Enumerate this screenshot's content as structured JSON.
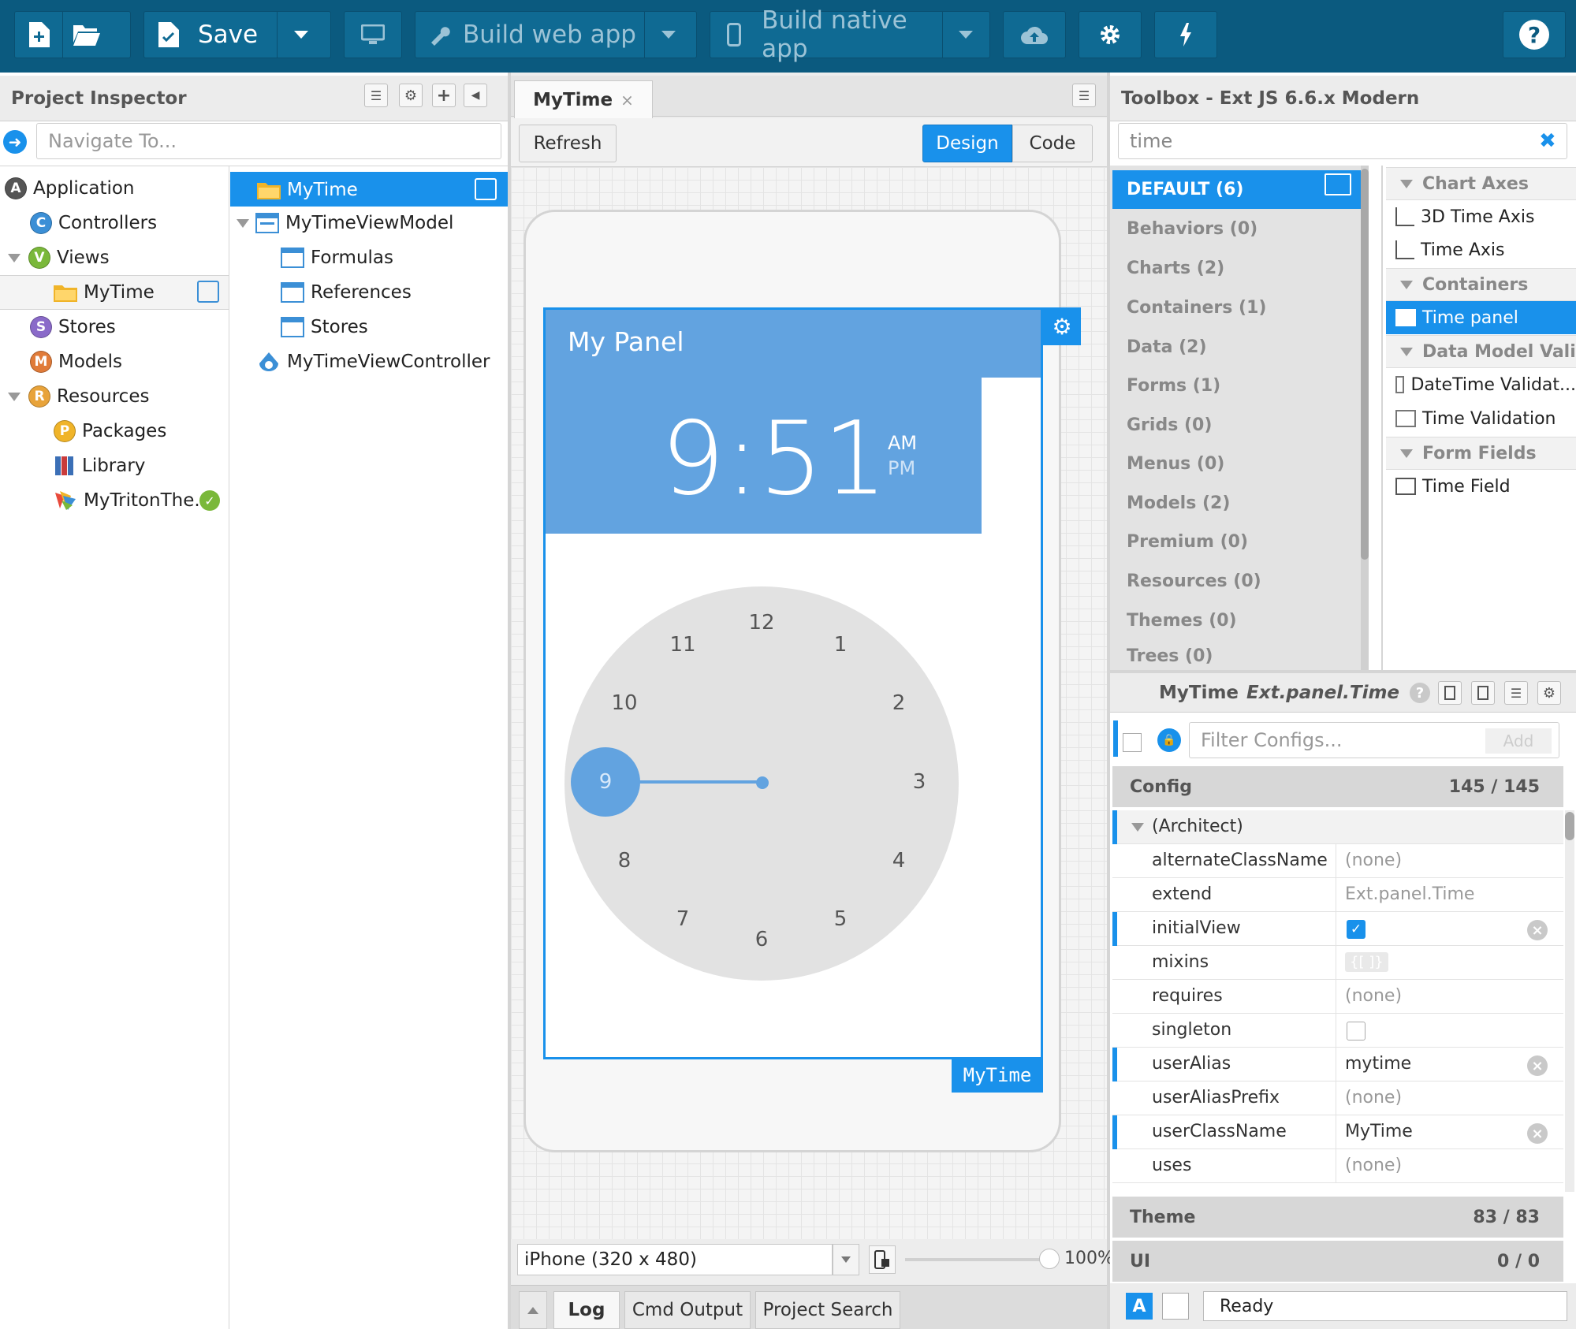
{
  "toolbar": {
    "save_label": "Save",
    "build_web_label": "Build web app",
    "build_native_label": "Build native app",
    "help_label": "?"
  },
  "project_inspector": {
    "title": "Project Inspector",
    "search_placeholder": "Navigate To...",
    "tree": [
      {
        "label": "Application",
        "icon": "A",
        "color": "#555555"
      },
      {
        "label": "Controllers",
        "icon": "C",
        "color": "#3b8fd6"
      },
      {
        "label": "Views",
        "icon": "V",
        "color": "#7ab83a"
      },
      {
        "label": "MyTime"
      },
      {
        "label": "Stores",
        "icon": "S",
        "color": "#8a6ac9"
      },
      {
        "label": "Models",
        "icon": "M",
        "color": "#e07b39"
      },
      {
        "label": "Resources",
        "icon": "R",
        "color": "#e8a33a"
      },
      {
        "label": "Packages",
        "icon": "P",
        "color": "#f0b429"
      },
      {
        "label": "Library"
      },
      {
        "label": "MyTritonThe.."
      }
    ],
    "detail_tree": [
      {
        "label": "MyTime"
      },
      {
        "label": "MyTimeViewModel"
      },
      {
        "label": "Formulas"
      },
      {
        "label": "References"
      },
      {
        "label": "Stores"
      },
      {
        "label": "MyTimeViewController"
      }
    ]
  },
  "canvas": {
    "tab_label": "MyTime",
    "tab_close": "×",
    "refresh_label": "Refresh",
    "design_label": "Design",
    "code_label": "Code",
    "panel_title": "My Panel",
    "time_text": "9:51",
    "am_label": "AM",
    "pm_label": "PM",
    "selected_hour": "9",
    "clock_numbers": [
      "12",
      "1",
      "2",
      "3",
      "4",
      "5",
      "6",
      "7",
      "8",
      "10",
      "11"
    ],
    "component_tag": "MyTime",
    "device_select": "iPhone (320 x 480)",
    "zoom_label": "100%",
    "accent_color": "#62a3e0"
  },
  "bottom_tabs": [
    "Log",
    "Cmd Output",
    "Project Search"
  ],
  "toolbox": {
    "title": "Toolbox - Ext JS 6.6.x Modern",
    "search_value": "time",
    "categories": [
      {
        "label": "DEFAULT (6)"
      },
      {
        "label": "Behaviors (0)"
      },
      {
        "label": "Charts (2)"
      },
      {
        "label": "Containers (1)"
      },
      {
        "label": "Data (2)"
      },
      {
        "label": "Forms (1)"
      },
      {
        "label": "Grids (0)"
      },
      {
        "label": "Menus (0)"
      },
      {
        "label": "Models (2)"
      },
      {
        "label": "Premium (0)"
      },
      {
        "label": "Resources (0)"
      },
      {
        "label": "Themes (0)"
      },
      {
        "label": "Trees (0)"
      }
    ],
    "section_chart_axes": "Chart Axes",
    "item_3d_time_axis": "3D Time Axis",
    "item_time_axis": "Time Axis",
    "section_containers": "Containers",
    "item_time_panel": "Time panel",
    "section_data_model": "Data Model Vali...",
    "item_datetime_validation": "DateTime Validat...",
    "item_time_validation": "Time Validation",
    "section_form_fields": "Form Fields",
    "item_time_field": "Time Field"
  },
  "config_panel": {
    "component_name": "MyTime",
    "component_class": "Ext.panel.Time",
    "filter_placeholder": "Filter Configs...",
    "add_label": "Add",
    "config_header": "Config",
    "config_count": "145 / 145",
    "architect_group": "(Architect)",
    "rows": [
      {
        "key": "alternateClassName",
        "value": "(none)"
      },
      {
        "key": "extend",
        "value": "Ext.panel.Time"
      },
      {
        "key": "initialView",
        "value": ""
      },
      {
        "key": "mixins",
        "value": "{[ ]}"
      },
      {
        "key": "requires",
        "value": "(none)"
      },
      {
        "key": "singleton",
        "value": ""
      },
      {
        "key": "userAlias",
        "value": "mytime"
      },
      {
        "key": "userAliasPrefix",
        "value": "(none)"
      },
      {
        "key": "userClassName",
        "value": "MyTime"
      },
      {
        "key": "uses",
        "value": "(none)"
      }
    ],
    "theme_header": "Theme",
    "theme_count": "83 / 83",
    "ui_header": "UI",
    "ui_count": "0 / 0",
    "status_text": "Ready",
    "status_a": "A"
  }
}
